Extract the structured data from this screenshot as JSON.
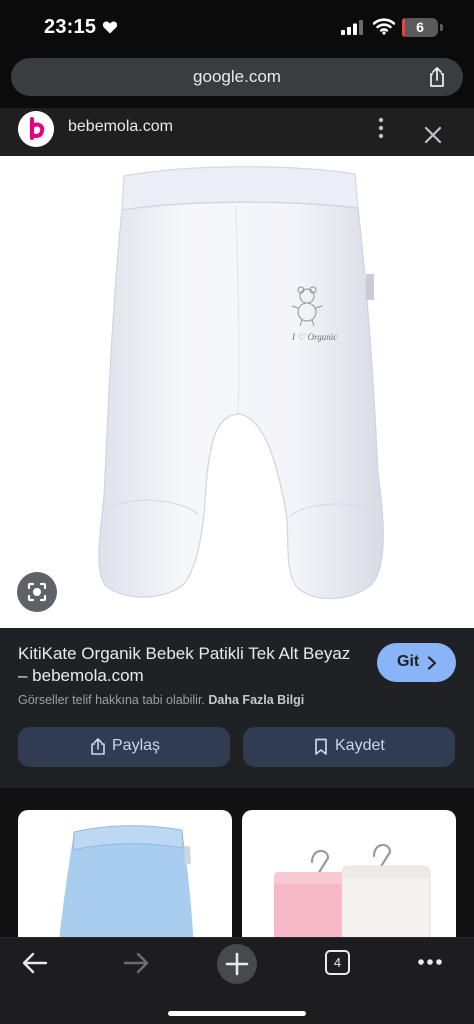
{
  "status_bar": {
    "time": "23:15",
    "battery_level": "6",
    "battery_fraction": 0.06
  },
  "browser": {
    "url": "google.com"
  },
  "sheet": {
    "site_name": "bebemola.com",
    "title": "KitiKate Organik Bebek Patikli Tek Alt Beyaz – bebemola.com",
    "visit_label": "Git",
    "copyright_text": "Görseller telif hakkına tabi olabilir.",
    "learn_more": "Daha Fazla Bilgi",
    "share_label": "Paylaş",
    "save_label": "Kaydet",
    "image_logo_text": "I ♡ Organic"
  },
  "toolbar": {
    "tab_count": "4"
  },
  "colors": {
    "accent": "#8ab4f8",
    "brand": "#e4007f",
    "panel": "#202124",
    "button": "#303c52"
  },
  "icons": [
    "heart-icon",
    "signal-icon",
    "wifi-icon",
    "share-icon",
    "more-icon",
    "close-icon",
    "lens-icon",
    "chevron-right-icon",
    "bookmark-icon",
    "back-arrow-icon",
    "forward-arrow-icon",
    "plus-icon",
    "menu-dots-icon"
  ]
}
